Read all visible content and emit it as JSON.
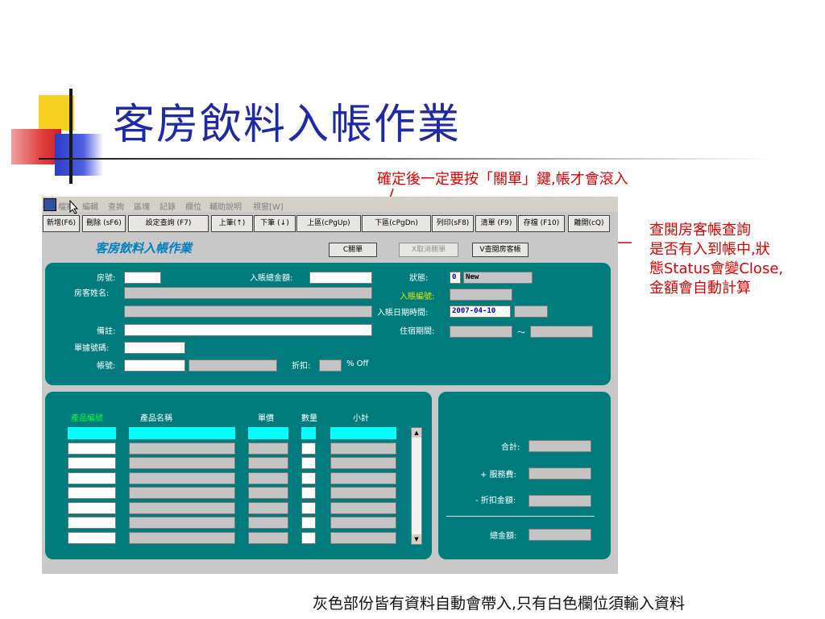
{
  "slide": {
    "title": "客房飲料入帳作業",
    "note_top": "確定後一定要按「關單」鍵,帳才會滾入",
    "note_right": [
      "查閱房客帳查詢",
      "是否有入到帳中,狀",
      "態Status會變Close,",
      "金額會自動計算"
    ],
    "note_bottom": "灰色部份皆有資料自動會帶入,只有白色欄位須輸入資料"
  },
  "app": {
    "menu": [
      "檔案",
      "編輯",
      "查詢",
      "區塊",
      "記錄",
      "欄位",
      "輔助說明",
      "視窗[W]"
    ],
    "toolbar": [
      "新增(F6)",
      "刪除 (sF6)",
      "設定查詢 (F7)",
      "上筆(↑)",
      "下筆 (↓)",
      "上區(cPgUp)",
      "下區(cPgDn)",
      "列印(sF8)",
      "清單 (F9)",
      "存檔 (F10)",
      "離開(cQ)"
    ],
    "form_title": "客房飲料入帳作業",
    "actions": {
      "close_bill": "C關單",
      "cancel_close": "X取消關單",
      "view_room_bill": "V查閱房客帳"
    },
    "header": {
      "room_no_label": "房號:",
      "guest_name_label": "房客姓名:",
      "note_label": "備註:",
      "voucher_no_label": "單據號碼:",
      "account_label": "帳號:",
      "total_label": "入賬總金額:",
      "discount_label": "折扣:",
      "discount_unit": "% Off",
      "status_label": "狀態:",
      "status_code": "0",
      "status_value": "New",
      "entry_no_label": "入賬編號:",
      "entry_datetime_label": "入賬日期時間:",
      "entry_date": "2007-04-10",
      "stay_period_label": "住宿期間:",
      "stay_sep": "～"
    },
    "detail": {
      "columns": [
        "產品編號",
        "產品名稱",
        "單價",
        "數量",
        "小計"
      ],
      "row_count": 8
    },
    "summary": {
      "subtotal_label": "合計:",
      "service_label": "+ 服務費:",
      "discount_amount_label": "- 折扣金額:",
      "grand_total_label": "總金額:"
    }
  },
  "colors": {
    "panel": "#007c7c",
    "title": "#1f2aa6",
    "note": "#e00000",
    "highlight": "#00ffff"
  }
}
